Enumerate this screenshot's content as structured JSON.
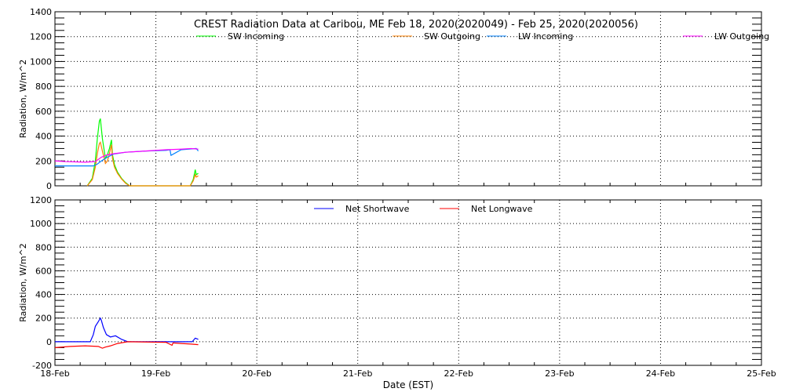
{
  "chart_data": [
    {
      "type": "line",
      "title": "CREST Radiation Data at Caribou, ME   Feb 18, 2020(2020049) - Feb 25, 2020(2020056)",
      "ylabel": "Radiation, W/m^2",
      "ylim": [
        0,
        1400
      ],
      "yticks": [
        0,
        200,
        400,
        600,
        800,
        1000,
        1200,
        1400
      ],
      "xlim": [
        0,
        7
      ],
      "grid": true,
      "legend": "top",
      "series": [
        {
          "name": "SW Incoming",
          "color": "#00ff00",
          "x": [
            0.32,
            0.37,
            0.4,
            0.42,
            0.44,
            0.45,
            0.47,
            0.5,
            0.52,
            0.54,
            0.56,
            0.57,
            0.59,
            0.62,
            0.66,
            0.7,
            0.74,
            1.34,
            1.37,
            1.39,
            1.4,
            1.42
          ],
          "y": [
            0,
            60,
            200,
            380,
            520,
            540,
            380,
            220,
            250,
            300,
            370,
            250,
            170,
            110,
            60,
            25,
            0,
            0,
            50,
            130,
            90,
            100
          ]
        },
        {
          "name": "SW Outgoing",
          "color": "#ff8000",
          "x": [
            0.32,
            0.37,
            0.4,
            0.42,
            0.44,
            0.45,
            0.47,
            0.5,
            0.52,
            0.54,
            0.56,
            0.57,
            0.59,
            0.62,
            0.66,
            0.7,
            0.74,
            1.34,
            1.37,
            1.39,
            1.4,
            1.42
          ],
          "y": [
            0,
            50,
            150,
            260,
            340,
            350,
            280,
            180,
            200,
            260,
            330,
            220,
            150,
            100,
            55,
            20,
            0,
            0,
            40,
            90,
            70,
            80
          ]
        },
        {
          "name": "LW Incoming",
          "color": "#0080ff",
          "x": [
            0,
            0.38,
            0.42,
            0.46,
            0.52,
            0.58,
            0.62,
            0.7,
            0.9,
            1.1,
            1.14,
            1.15,
            1.25,
            1.4,
            1.42
          ],
          "y": [
            160,
            160,
            175,
            200,
            230,
            255,
            260,
            270,
            280,
            285,
            290,
            245,
            290,
            300,
            280
          ]
        },
        {
          "name": "LW Outgoing",
          "color": "#ff00ff",
          "x": [
            0,
            0.1,
            0.3,
            0.4,
            0.46,
            0.52,
            0.6,
            0.7,
            0.9,
            1.1,
            1.25,
            1.35,
            1.42
          ],
          "y": [
            200,
            195,
            190,
            195,
            230,
            250,
            260,
            270,
            280,
            290,
            295,
            300,
            295
          ]
        }
      ],
      "xticks": [
        "18-Feb",
        "19-Feb",
        "20-Feb",
        "21-Feb",
        "22-Feb",
        "23-Feb",
        "24-Feb",
        "25-Feb"
      ]
    },
    {
      "type": "line",
      "ylabel": "Radiation, W/m^2",
      "xlabel": "Date (EST)",
      "ylim": [
        -200,
        1200
      ],
      "yticks": [
        -200,
        0,
        200,
        400,
        600,
        800,
        1000,
        1200
      ],
      "xlim": [
        0,
        7
      ],
      "grid": true,
      "legend": "top",
      "series": [
        {
          "name": "Net Shortwave",
          "color": "#0000ff",
          "x": [
            0,
            0.35,
            0.38,
            0.4,
            0.43,
            0.45,
            0.46,
            0.48,
            0.51,
            0.55,
            0.6,
            0.66,
            0.72,
            1.36,
            1.37,
            1.39,
            1.42
          ],
          "y": [
            0,
            0,
            60,
            130,
            170,
            200,
            180,
            120,
            60,
            40,
            50,
            20,
            0,
            0,
            10,
            30,
            20
          ]
        },
        {
          "name": "Net Longwave",
          "color": "#ff0000",
          "x": [
            0,
            0.15,
            0.3,
            0.43,
            0.47,
            0.5,
            0.55,
            0.62,
            0.72,
            1.1,
            1.16,
            1.17,
            1.25,
            1.35,
            1.42
          ],
          "y": [
            -50,
            -40,
            -35,
            -40,
            -55,
            -45,
            -35,
            -15,
            0,
            -5,
            -30,
            -10,
            -15,
            -20,
            -25
          ]
        }
      ],
      "xticks": [
        "18-Feb",
        "19-Feb",
        "20-Feb",
        "21-Feb",
        "22-Feb",
        "23-Feb",
        "24-Feb",
        "25-Feb"
      ]
    }
  ]
}
